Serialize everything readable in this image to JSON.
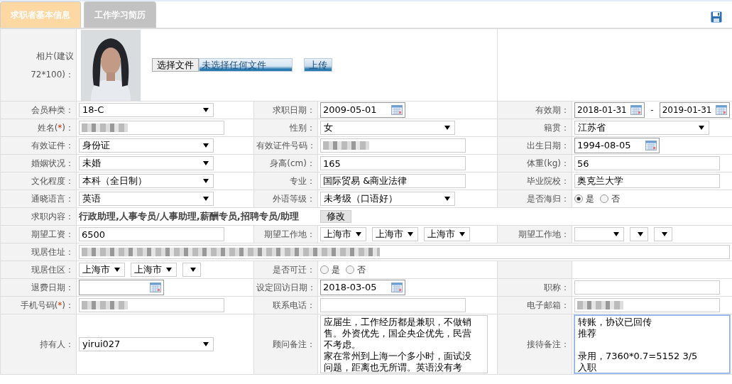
{
  "tabs": [
    {
      "label": "求职者基本信息",
      "selected": true
    },
    {
      "label": "工作学习简历",
      "selected": false
    }
  ],
  "photo_row": {
    "label": "相片(建议72*100)：",
    "file_button": "选择文件",
    "file_status": "未选择任何文件",
    "upload_button": "上传"
  },
  "rows": [
    {
      "cells": [
        {
          "label": "会员种类：",
          "field": {
            "kind": "select",
            "value": "18-C"
          }
        },
        {
          "label": "求职日期：",
          "field": {
            "kind": "date",
            "value": "2009-05-01"
          }
        },
        {
          "label": "有效期：",
          "field": {
            "kind": "date_range",
            "values": [
              "2018-01-31",
              "2019-01-31"
            ],
            "separator": "-"
          }
        }
      ]
    },
    {
      "cells": [
        {
          "label": "姓名(",
          "required_mark": "*",
          "label_end": ")：",
          "field": {
            "kind": "text",
            "redacted": true
          }
        },
        {
          "label": "性别：",
          "field": {
            "kind": "select",
            "value": "女"
          }
        },
        {
          "label": "籍贯：",
          "field": {
            "kind": "select",
            "value": "江苏省"
          }
        }
      ]
    },
    {
      "cells": [
        {
          "label": "有效证件：",
          "field": {
            "kind": "select",
            "value": "身份证"
          }
        },
        {
          "label": "有效证件号码：",
          "field": {
            "kind": "text",
            "redacted": true
          }
        },
        {
          "label": "出生日期：",
          "field": {
            "kind": "date",
            "value": "1994-08-05"
          }
        }
      ]
    },
    {
      "cells": [
        {
          "label": "婚姻状况：",
          "field": {
            "kind": "select",
            "value": "未婚"
          }
        },
        {
          "label": "身高(cm)：",
          "field": {
            "kind": "text",
            "value": "165"
          }
        },
        {
          "label": "体重(kg)：",
          "field": {
            "kind": "text",
            "value": "56"
          }
        }
      ]
    },
    {
      "cells": [
        {
          "label": "文化程度：",
          "field": {
            "kind": "select",
            "value": "本科（全日制）"
          }
        },
        {
          "label": "专业：",
          "field": {
            "kind": "text",
            "value": "国际贸易 &商业法律"
          }
        },
        {
          "label": "毕业院校：",
          "field": {
            "kind": "text",
            "value": "奥克兰大学"
          }
        }
      ]
    },
    {
      "cells": [
        {
          "label": "通晓语言：",
          "field": {
            "kind": "select",
            "value": "英语"
          }
        },
        {
          "label": "外语等级：",
          "field": {
            "kind": "select",
            "value": "未考级（口语好）"
          }
        },
        {
          "label": "是否海归：",
          "field": {
            "kind": "radio",
            "options": [
              {
                "label": "是",
                "selected": true
              },
              {
                "label": "否",
                "selected": false
              }
            ]
          }
        }
      ]
    },
    {
      "cells": [
        {
          "label": "求职内容：",
          "wide": true,
          "field": {
            "kind": "static",
            "value": "行政助理,人事专员/人事助理,薪酬专员,招聘专员/助理",
            "button": "修改"
          }
        }
      ]
    },
    {
      "cells": [
        {
          "label": "期望工资：",
          "field": {
            "kind": "text",
            "value": "6500"
          }
        },
        {
          "label": "期望工作地：",
          "field": {
            "kind": "select_group",
            "selects": [
              {
                "value": "上海市"
              },
              {
                "value": "上海市"
              },
              {
                "value": "上海市"
              }
            ]
          }
        },
        {
          "label": "期望工作地：",
          "field": {
            "kind": "select_group",
            "selects": [
              {
                "blank": true
              },
              {
                "blank": true
              },
              {
                "blank": true
              }
            ]
          }
        }
      ]
    },
    {
      "cells": [
        {
          "label": "现居住址：",
          "wide": true,
          "field": {
            "kind": "text",
            "redacted": true
          }
        }
      ]
    },
    {
      "cells": [
        {
          "label": "现居住区：",
          "field": {
            "kind": "select_group",
            "selects": [
              {
                "value": "上海市"
              },
              {
                "value": "上海市"
              },
              {
                "blank": true
              }
            ]
          }
        },
        {
          "label": "是否可迁：",
          "field": {
            "kind": "radio",
            "options": [
              {
                "label": "是",
                "selected": false
              },
              {
                "label": "否",
                "selected": false
              }
            ]
          }
        },
        {
          "field": {
            "kind": "none"
          }
        }
      ]
    },
    {
      "cells": [
        {
          "label": "退费日期：",
          "field": {
            "kind": "date"
          }
        },
        {
          "label": "设定回访日期：",
          "field": {
            "kind": "date",
            "value": "2018-03-05"
          }
        },
        {
          "label": "职称：",
          "field": {
            "kind": "text"
          }
        }
      ]
    },
    {
      "cells": [
        {
          "label": "手机号码(",
          "required_mark": "*",
          "label_end": ")：",
          "field": {
            "kind": "text",
            "redacted": true
          }
        },
        {
          "label": "联系电话：",
          "field": {
            "kind": "text"
          }
        },
        {
          "label": "电子邮箱：",
          "field": {
            "kind": "text",
            "redacted": true
          }
        }
      ]
    },
    {
      "cells": [
        {
          "label": "持有人：",
          "field": {
            "kind": "select",
            "value": "yirui027"
          }
        },
        {
          "label": "顾问备注：",
          "field": {
            "kind": "textarea",
            "focused": false,
            "paragraphs": [
              {
                "text": "应届生，工作经历都是兼职，不做销售。外资优先，国企央企优先，民营不考虑。"
              },
              {
                "text": "家在常州到上海一个多小时，面试没问题，距离也无所谓。英语没有考"
              }
            ]
          }
        },
        {
          "label": "接待备注：",
          "field": {
            "kind": "textarea",
            "focused": true,
            "paragraphs": [
              {
                "text": "转账，协议已回传"
              },
              {
                "text": "推荐"
              },
              {
                "text": "录用，7360*0.7=5152  3/5",
                "spaced": true
              },
              {
                "text": "入职"
              }
            ]
          }
        }
      ]
    }
  ]
}
